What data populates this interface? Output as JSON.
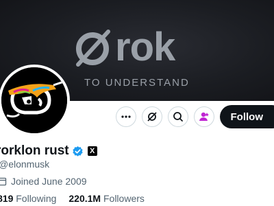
{
  "banner": {
    "wordmark": "rok",
    "tagline": "TO UNDERSTAND"
  },
  "actions": {
    "more_icon": "more-horizontal-icon",
    "grok_icon": "grok-icon",
    "search_icon": "search-icon",
    "subscribe_icon": "subscribe-person-icon",
    "follow_label": "Follow"
  },
  "profile": {
    "display_name": "rorklon rust",
    "verified_color": "#1d9bf0",
    "affiliate_badge": "X",
    "handle": "@elonmusk",
    "joined": "Joined June 2009",
    "following_count": "819",
    "following_label": "Following",
    "followers_count": "220.1M",
    "followers_label": "Followers"
  }
}
